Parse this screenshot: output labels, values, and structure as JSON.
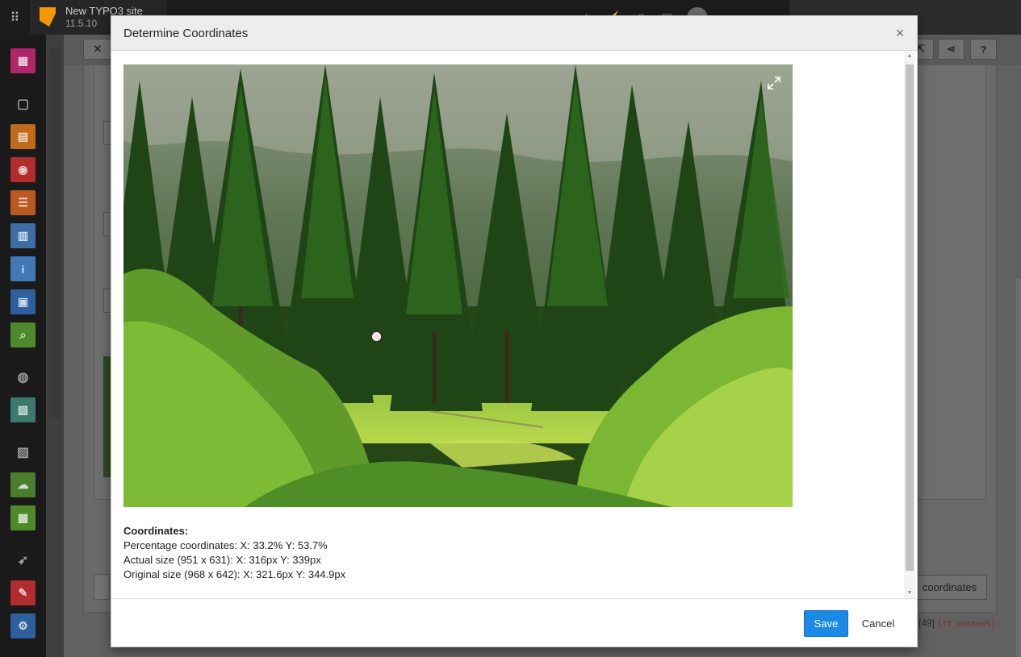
{
  "topbar": {
    "site_name": "New TYPO3 site",
    "site_version": "11.5.10"
  },
  "background": {
    "coordinates_button_label": "coordinates",
    "record_id": "[49]",
    "record_table": "[tt_content]"
  },
  "modal": {
    "title": "Determine Coordinates",
    "close_glyph": "×",
    "coordinates": {
      "heading": "Coordinates:",
      "percentage": "Percentage coordinates: X: 33.2% Y: 53.7%",
      "actual": "Actual size (951 x 631): X: 316px Y: 339px",
      "original": "Original size (968 x 642): X: 321.6px Y: 344.9px"
    },
    "marker": {
      "x_percent": 38,
      "y_percent": 61.7
    },
    "save_label": "Save",
    "cancel_label": "Cancel"
  },
  "colors": {
    "save_button": "#1a8ae6",
    "modal_header": "#ededed"
  }
}
